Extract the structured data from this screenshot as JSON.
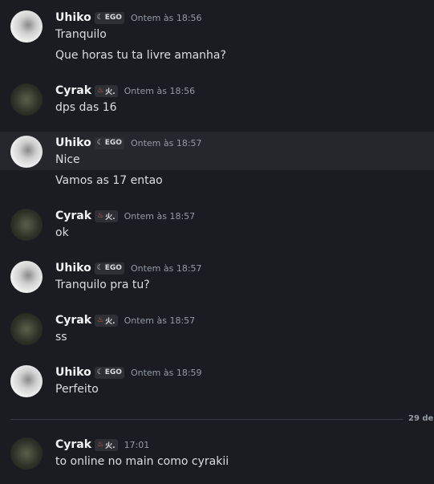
{
  "messages": [
    {
      "author": "Uhiko",
      "tag": "EGO",
      "tag_icon": "moon-icon",
      "time": "Ontem às 18:56",
      "lines": [
        "Tranquilo",
        "Que horas tu ta livre amanha?"
      ]
    },
    {
      "author": "Cyrak",
      "tag": "火.",
      "tag_icon": "fire-icon",
      "time": "Ontem às 18:56",
      "lines": [
        "dps das 16"
      ]
    },
    {
      "author": "Uhiko",
      "tag": "EGO",
      "tag_icon": "moon-icon",
      "time": "Ontem às 18:57",
      "lines": [
        "Nice",
        "Vamos as 17 entao"
      ]
    },
    {
      "author": "Cyrak",
      "tag": "火.",
      "tag_icon": "fire-icon",
      "time": "Ontem às 18:57",
      "lines": [
        "ok"
      ]
    },
    {
      "author": "Uhiko",
      "tag": "EGO",
      "tag_icon": "moon-icon",
      "time": "Ontem às 18:57",
      "lines": [
        "Tranquilo pra tu?"
      ]
    },
    {
      "author": "Cyrak",
      "tag": "火.",
      "tag_icon": "fire-icon",
      "time": "Ontem às 18:57",
      "lines": [
        "ss"
      ]
    },
    {
      "author": "Uhiko",
      "tag": "EGO",
      "tag_icon": "moon-icon",
      "time": "Ontem às 18:59",
      "lines": [
        "Perfeito"
      ]
    },
    {
      "author": "Cyrak",
      "tag": "火.",
      "tag_icon": "fire-icon",
      "time": "17:01",
      "lines": [
        "to online no main como cyrakii"
      ]
    }
  ],
  "date_divider": "29 de",
  "colors": {
    "background": "#1b1c21",
    "highlight": "#26272c",
    "author": "#f2f3f5",
    "timestamp": "#949ba4"
  }
}
